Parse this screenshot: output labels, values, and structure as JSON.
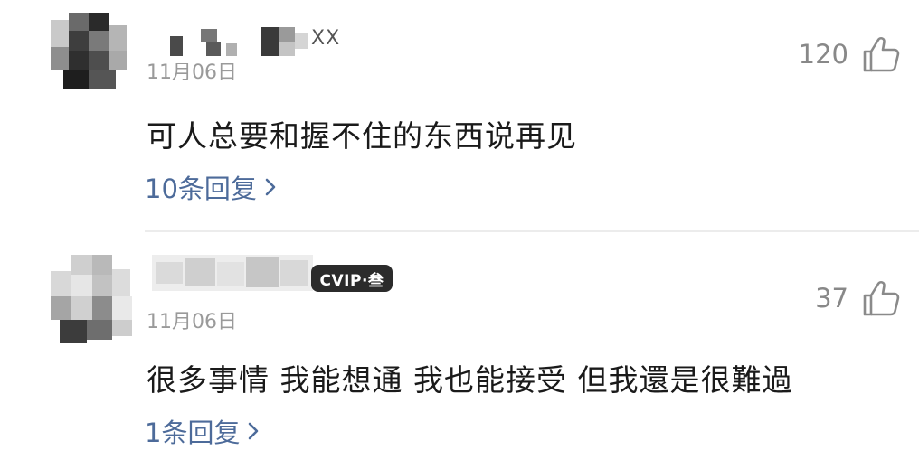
{
  "comments": [
    {
      "name_suffix": "XX",
      "date": "11月06日",
      "text": "可人总要和握不住的东西说再见",
      "replies": "10条回复",
      "likes": "120"
    },
    {
      "vip_badge": "CVIP·叁",
      "date": "11月06日",
      "text": "很多事情 我能想通 我也能接受 但我還是很難過",
      "replies": "1条回复",
      "likes": "37"
    }
  ],
  "icons": {
    "like": "thumbs-up-icon",
    "reply_arrow": "chevron-right-icon"
  },
  "colors": {
    "link": "#4d6b9a",
    "muted": "#9a9a9a",
    "text": "#1a1a1a"
  }
}
